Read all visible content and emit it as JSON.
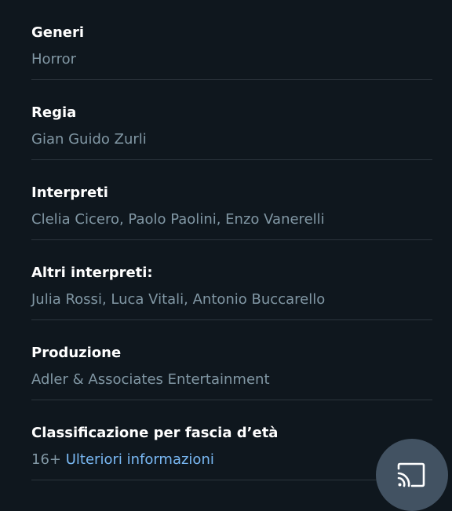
{
  "details": {
    "generi": {
      "label": "Generi",
      "value": "Horror"
    },
    "regia": {
      "label": "Regia",
      "value": "Gian Guido Zurli"
    },
    "interpreti": {
      "label": "Interpreti",
      "value": "Clelia Cicero, Paolo Paolini, Enzo Vanerelli"
    },
    "altri_interpreti": {
      "label": "Altri interpreti:",
      "value": "Julia Rossi, Luca Vitali, Antonio Buccarello"
    },
    "produzione": {
      "label": "Produzione",
      "value": "Adler & Associates Entertainment"
    },
    "classificazione": {
      "label": "Classificazione per fascia d’età",
      "rating": "16+",
      "more_info_link": "Ulteriori informazioni"
    }
  },
  "cast_button": {
    "icon": "cast-icon"
  },
  "colors": {
    "background": "#0f171e",
    "label": "#ffffff",
    "value": "#8197a4",
    "link": "#79b8f3",
    "divider": "#2c353d",
    "cast_button": "#425262"
  }
}
